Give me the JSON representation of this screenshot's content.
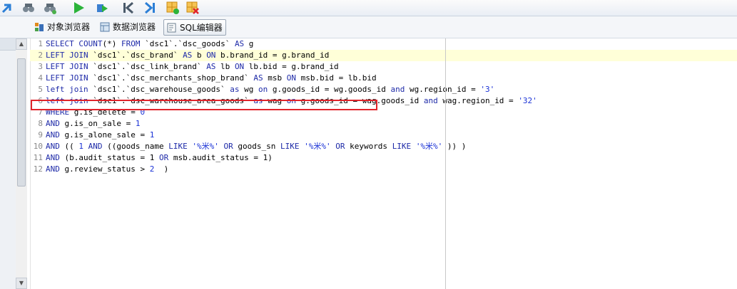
{
  "tabs": [
    {
      "label": "对象浏览器",
      "icon": "object-browser-icon"
    },
    {
      "label": "数据浏览器",
      "icon": "data-browser-icon"
    },
    {
      "label": "SQL编辑器",
      "icon": "sql-editor-icon",
      "active": true
    }
  ],
  "toolbar": {
    "icons": [
      "back-arrow-icon",
      "binoculars-icon",
      "binoculars-refresh-icon",
      "run-icon",
      "step-run-icon",
      "first-record-icon",
      "last-record-icon",
      "grid-add-icon",
      "grid-delete-icon"
    ]
  },
  "editor": {
    "current_line": 2,
    "highlighted_line": 3,
    "lines": [
      {
        "n": "1",
        "tokens": [
          [
            "kw",
            "SELECT COUNT"
          ],
          [
            "txt",
            "(*) "
          ],
          [
            "kw",
            "FROM"
          ],
          [
            "txt",
            " `dsc1`.`dsc_goods` "
          ],
          [
            "kw",
            "AS"
          ],
          [
            "txt",
            " g"
          ]
        ]
      },
      {
        "n": "2",
        "tokens": [
          [
            "kw",
            "LEFT JOIN"
          ],
          [
            "txt",
            " `dsc1`.`dsc_brand` "
          ],
          [
            "kw",
            "AS"
          ],
          [
            "txt",
            " b "
          ],
          [
            "kw",
            "ON"
          ],
          [
            "txt",
            " b.brand_id = g.brand_id"
          ]
        ]
      },
      {
        "n": "3",
        "tokens": [
          [
            "kw",
            "LEFT JOIN"
          ],
          [
            "txt",
            " `dsc1`.`dsc_link_brand` "
          ],
          [
            "kw",
            "AS"
          ],
          [
            "txt",
            " lb "
          ],
          [
            "kw",
            "ON"
          ],
          [
            "txt",
            " lb.bid = g.brand_id"
          ]
        ]
      },
      {
        "n": "4",
        "tokens": [
          [
            "kw",
            "LEFT JOIN"
          ],
          [
            "txt",
            " `dsc1`.`dsc_merchants_shop_brand` "
          ],
          [
            "kw",
            "AS"
          ],
          [
            "txt",
            " msb "
          ],
          [
            "kw",
            "ON"
          ],
          [
            "txt",
            " msb.bid = lb.bid"
          ]
        ]
      },
      {
        "n": "5",
        "tokens": [
          [
            "kw",
            "left join"
          ],
          [
            "txt",
            " `dsc1`.`dsc_warehouse_goods` "
          ],
          [
            "kw",
            "as"
          ],
          [
            "txt",
            " wg "
          ],
          [
            "kw",
            "on"
          ],
          [
            "txt",
            " g.goods_id = wg.goods_id "
          ],
          [
            "kw",
            "and"
          ],
          [
            "txt",
            " wg.region_id = "
          ],
          [
            "str",
            "'3'"
          ]
        ]
      },
      {
        "n": "6",
        "tokens": [
          [
            "kw",
            "left join"
          ],
          [
            "txt",
            " `dsc1`.`dsc_warehouse_area_goods` "
          ],
          [
            "kw",
            "as"
          ],
          [
            "txt",
            " wag "
          ],
          [
            "kw",
            "on"
          ],
          [
            "txt",
            " g.goods_id = wag.goods_id "
          ],
          [
            "kw",
            "and"
          ],
          [
            "txt",
            " wag.region_id = "
          ],
          [
            "str",
            "'32'"
          ]
        ]
      },
      {
        "n": "7",
        "tokens": [
          [
            "kw",
            "WHERE"
          ],
          [
            "txt",
            " g.is_delete = "
          ],
          [
            "num",
            "0"
          ]
        ]
      },
      {
        "n": "8",
        "tokens": [
          [
            "kw",
            "AND"
          ],
          [
            "txt",
            " g.is_on_sale = "
          ],
          [
            "num",
            "1"
          ]
        ]
      },
      {
        "n": "9",
        "tokens": [
          [
            "kw",
            "AND"
          ],
          [
            "txt",
            " g.is_alone_sale = "
          ],
          [
            "num",
            "1"
          ]
        ]
      },
      {
        "n": "10",
        "tokens": [
          [
            "kw",
            "AND"
          ],
          [
            "txt",
            " (( "
          ],
          [
            "num",
            "1"
          ],
          [
            "txt",
            " "
          ],
          [
            "kw",
            "AND"
          ],
          [
            "txt",
            " ((goods_name "
          ],
          [
            "kw",
            "LIKE"
          ],
          [
            "txt",
            " "
          ],
          [
            "str",
            "'%米%'"
          ],
          [
            "txt",
            " "
          ],
          [
            "kw",
            "OR"
          ],
          [
            "txt",
            " goods_sn "
          ],
          [
            "kw",
            "LIKE"
          ],
          [
            "txt",
            " "
          ],
          [
            "str",
            "'%米%'"
          ],
          [
            "txt",
            " "
          ],
          [
            "kw",
            "OR"
          ],
          [
            "txt",
            " keywords "
          ],
          [
            "kw",
            "LIKE"
          ],
          [
            "txt",
            " "
          ],
          [
            "str",
            "'%米%'"
          ],
          [
            "txt",
            " )) )"
          ]
        ]
      },
      {
        "n": "11",
        "tokens": [
          [
            "kw",
            "AND"
          ],
          [
            "txt",
            " (b.audit_status = 1 "
          ],
          [
            "kw",
            "OR"
          ],
          [
            "txt",
            " msb.audit_status = 1)"
          ]
        ]
      },
      {
        "n": "12",
        "tokens": [
          [
            "kw",
            "AND"
          ],
          [
            "txt",
            " g.review_status > "
          ],
          [
            "num",
            "2"
          ],
          [
            "txt",
            "  )"
          ]
        ]
      }
    ]
  }
}
